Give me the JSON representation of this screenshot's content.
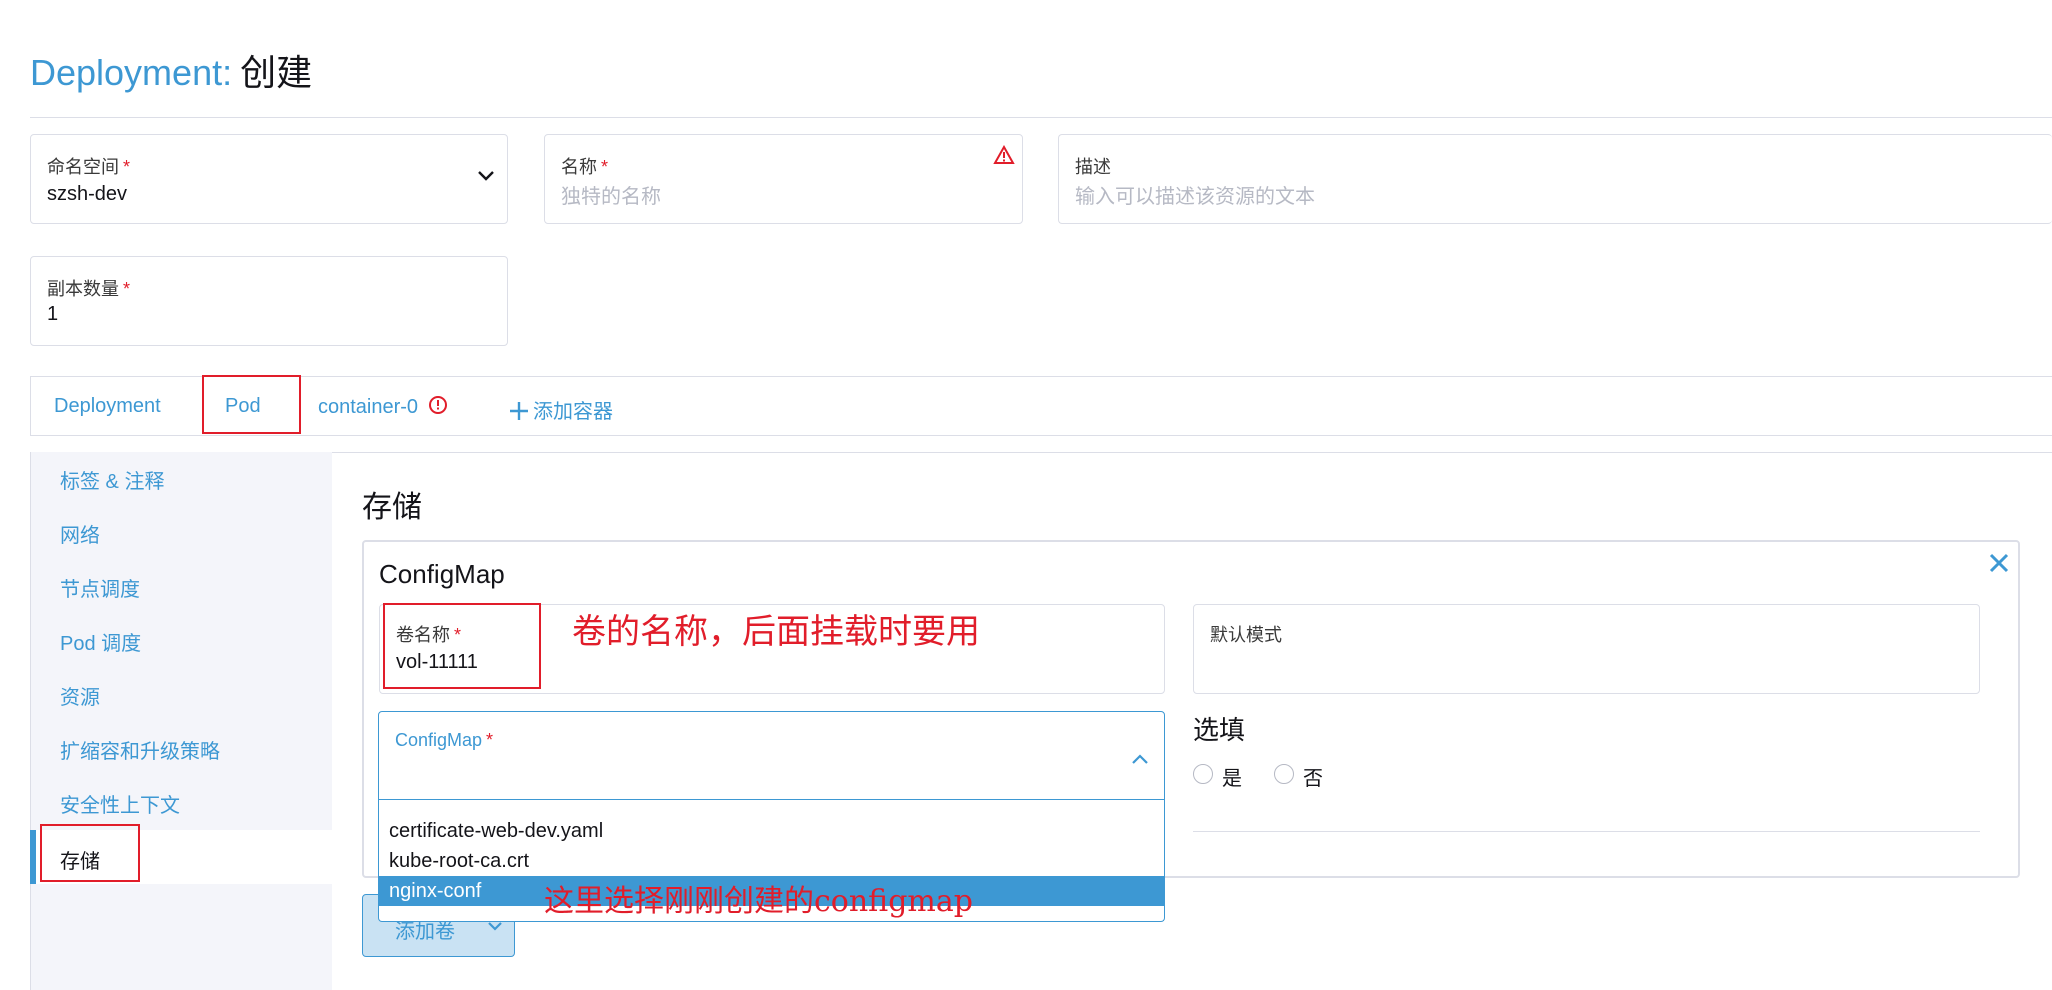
{
  "page": {
    "title_resource": "Deployment:",
    "title_action": "创建"
  },
  "fields": {
    "namespace": {
      "label": "命名空间",
      "required_mark": "*",
      "value": "szsh-dev"
    },
    "name": {
      "label": "名称",
      "required_mark": "*",
      "placeholder": "独特的名称"
    },
    "description": {
      "label": "描述",
      "placeholder": "输入可以描述该资源的文本"
    },
    "replicas": {
      "label": "副本数量",
      "required_mark": "*",
      "value": "1"
    }
  },
  "tabs": {
    "deployment": "Deployment",
    "pod": "Pod",
    "container": "container-0",
    "add_container": "添加容器"
  },
  "sidebar": {
    "items": [
      {
        "label": "标签 & 注释"
      },
      {
        "label": "网络"
      },
      {
        "label": "节点调度"
      },
      {
        "label": "Pod 调度"
      },
      {
        "label": "资源"
      },
      {
        "label": "扩缩容和升级策略"
      },
      {
        "label": "安全性上下文"
      },
      {
        "label": "存储"
      }
    ],
    "active_index": 7
  },
  "storage": {
    "heading": "存储",
    "card_title": "ConfigMap",
    "volume_name": {
      "label": "卷名称",
      "required_mark": "*",
      "value": "vol-11111"
    },
    "default_mode": {
      "label": "默认模式"
    },
    "configmap": {
      "label": "ConfigMap",
      "required_mark": "*"
    },
    "optional": {
      "label": "选填",
      "yes": "是",
      "no": "否"
    },
    "dropdown_options": [
      "certificate-web-dev.yaml",
      "kube-root-ca.crt",
      "nginx-conf"
    ],
    "selected_option": "nginx-conf",
    "add_volume_button": "添加卷"
  },
  "annotations": {
    "volume_name_note": "卷的名称，后面挂载时要用",
    "configmap_note": "这里选择刚刚创建的configmap"
  },
  "colors": {
    "accent": "#3d98d3",
    "error": "#e11d2a",
    "border": "#dcdee7",
    "sidebar_bg": "#f4f5fa"
  },
  "icons": {
    "namespace_dropdown": "chevron-down-icon",
    "name_error": "warning-triangle-icon",
    "container_error": "error-circle-icon",
    "add_container": "plus-icon",
    "card_close": "close-icon",
    "configmap_dropdown": "chevron-up-icon",
    "add_volume_dropdown": "chevron-down-icon"
  }
}
